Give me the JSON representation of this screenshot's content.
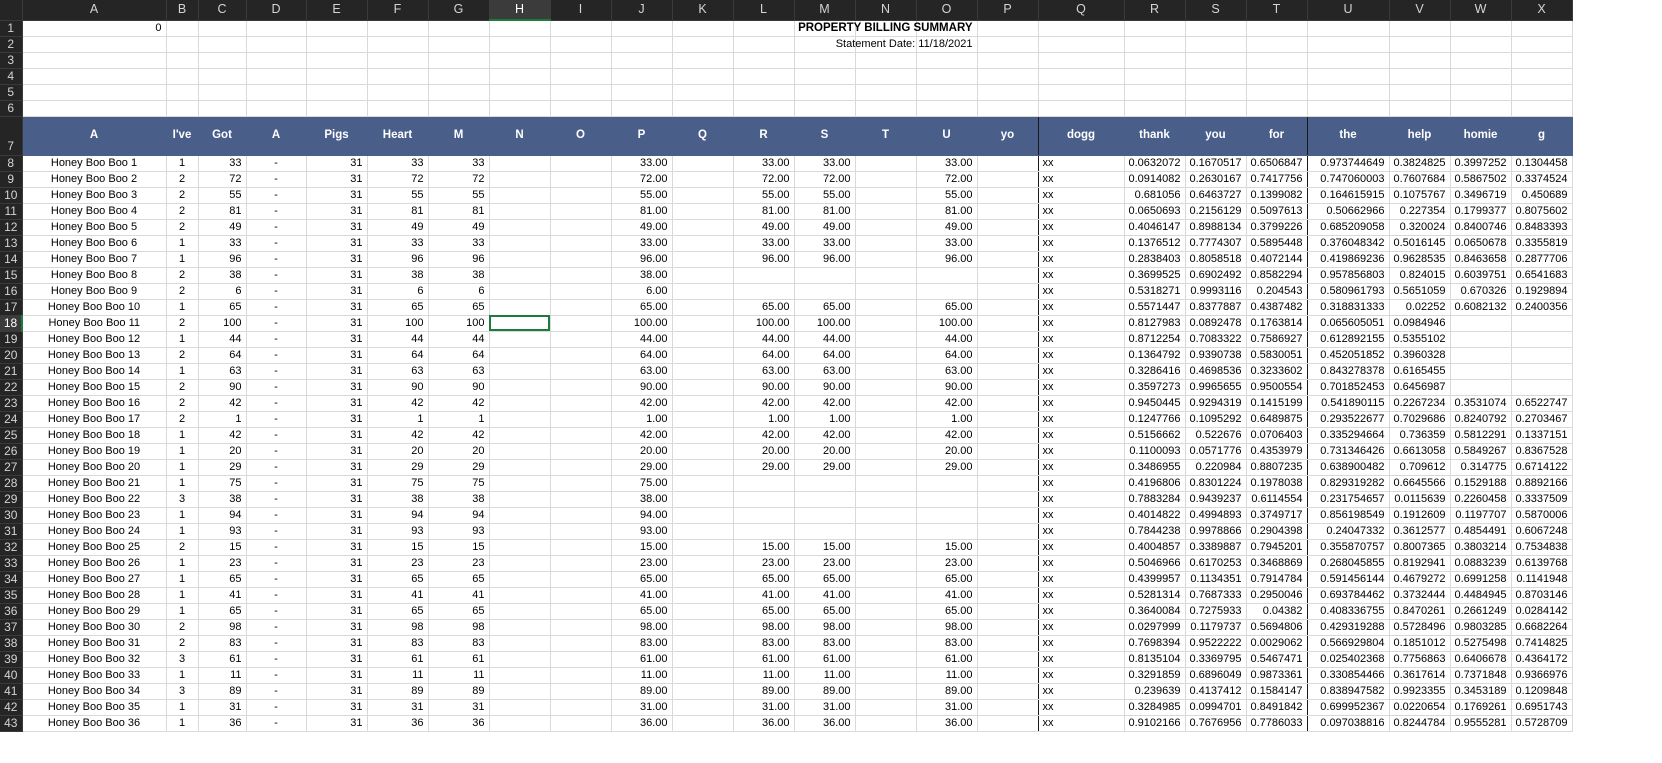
{
  "columns": [
    "A",
    "B",
    "C",
    "D",
    "E",
    "F",
    "G",
    "H",
    "I",
    "J",
    "K",
    "L",
    "M",
    "N",
    "O",
    "P",
    "Q",
    "R",
    "S",
    "T",
    "U",
    "V",
    "W",
    "X"
  ],
  "selected_column": "H",
  "selected_row": "18",
  "top": {
    "b1_value": "0",
    "title": "PROPERTY BILLING SUMMARY",
    "statement": "Statement Date: 11/18/2021"
  },
  "header_row": [
    "A",
    "I've",
    "Got",
    "A",
    "Pigs",
    "Heart",
    "M",
    "N",
    "O",
    "P",
    "Q",
    "R",
    "S",
    "T",
    "U",
    "yo",
    "dogg",
    "thank",
    "you",
    "for",
    "the",
    "help",
    "homie",
    "g"
  ],
  "accent_color": "#4a5e8a",
  "rows": [
    [
      "8",
      "Honey Boo Boo 1",
      "1",
      "33",
      "-",
      "31",
      "33",
      "33",
      "",
      "",
      "33.00",
      "",
      "33.00",
      "33.00",
      "",
      "33.00",
      "",
      "xx",
      "0.0632072",
      "0.1670517",
      "0.6506847",
      "0.973744649",
      "0.3824825",
      "0.3997252",
      "0.1304458"
    ],
    [
      "9",
      "Honey Boo Boo 2",
      "2",
      "72",
      "-",
      "31",
      "72",
      "72",
      "",
      "",
      "72.00",
      "",
      "72.00",
      "72.00",
      "",
      "72.00",
      "",
      "xx",
      "0.0914082",
      "0.2630167",
      "0.7417756",
      "0.747060003",
      "0.7607684",
      "0.5867502",
      "0.3374524"
    ],
    [
      "10",
      "Honey Boo Boo 3",
      "2",
      "55",
      "-",
      "31",
      "55",
      "55",
      "",
      "",
      "55.00",
      "",
      "55.00",
      "55.00",
      "",
      "55.00",
      "",
      "xx",
      "0.681056",
      "0.6463727",
      "0.1399082",
      "0.164615915",
      "0.1075767",
      "0.3496719",
      "0.450689"
    ],
    [
      "11",
      "Honey Boo Boo 4",
      "2",
      "81",
      "-",
      "31",
      "81",
      "81",
      "",
      "",
      "81.00",
      "",
      "81.00",
      "81.00",
      "",
      "81.00",
      "",
      "xx",
      "0.0650693",
      "0.2156129",
      "0.5097613",
      "0.50662966",
      "0.227354",
      "0.1799377",
      "0.8075602"
    ],
    [
      "12",
      "Honey Boo Boo 5",
      "2",
      "49",
      "-",
      "31",
      "49",
      "49",
      "",
      "",
      "49.00",
      "",
      "49.00",
      "49.00",
      "",
      "49.00",
      "",
      "xx",
      "0.4046147",
      "0.8988134",
      "0.3799226",
      "0.685209058",
      "0.320024",
      "0.8400746",
      "0.8483393"
    ],
    [
      "13",
      "Honey Boo Boo 6",
      "1",
      "33",
      "-",
      "31",
      "33",
      "33",
      "",
      "",
      "33.00",
      "",
      "33.00",
      "33.00",
      "",
      "33.00",
      "",
      "xx",
      "0.1376512",
      "0.7774307",
      "0.5895448",
      "0.376048342",
      "0.5016145",
      "0.0650678",
      "0.3355819"
    ],
    [
      "14",
      "Honey Boo Boo 7",
      "1",
      "96",
      "-",
      "31",
      "96",
      "96",
      "",
      "",
      "96.00",
      "",
      "96.00",
      "96.00",
      "",
      "96.00",
      "",
      "xx",
      "0.2838403",
      "0.8058518",
      "0.4072144",
      "0.419869236",
      "0.9628535",
      "0.8463658",
      "0.2877706"
    ],
    [
      "15",
      "Honey Boo Boo 8",
      "2",
      "38",
      "-",
      "31",
      "38",
      "38",
      "",
      "",
      "38.00",
      "",
      "",
      "",
      "",
      "",
      "",
      "xx",
      "0.3699525",
      "0.6902492",
      "0.8582294",
      "0.957856803",
      "0.824015",
      "0.6039751",
      "0.6541683"
    ],
    [
      "16",
      "Honey Boo Boo 9",
      "2",
      "6",
      "-",
      "31",
      "6",
      "6",
      "",
      "",
      "6.00",
      "",
      "",
      "",
      "",
      "",
      "",
      "xx",
      "0.5318271",
      "0.9993116",
      "0.204543",
      "0.580961793",
      "0.5651059",
      "0.670326",
      "0.1929894"
    ],
    [
      "17",
      "Honey Boo Boo 10",
      "1",
      "65",
      "-",
      "31",
      "65",
      "65",
      "",
      "",
      "65.00",
      "",
      "65.00",
      "65.00",
      "",
      "65.00",
      "",
      "xx",
      "0.5571447",
      "0.8377887",
      "0.4387482",
      "0.318831333",
      "0.02252",
      "0.6082132",
      "0.2400356"
    ],
    [
      "18",
      "Honey Boo Boo 11",
      "2",
      "100",
      "-",
      "31",
      "100",
      "100",
      "",
      "",
      "100.00",
      "",
      "100.00",
      "100.00",
      "",
      "100.00",
      "",
      "xx",
      "0.8127983",
      "0.0892478",
      "0.1763814",
      "0.065605051",
      "0.0984946",
      "",
      ""
    ],
    [
      "19",
      "Honey Boo Boo 12",
      "1",
      "44",
      "-",
      "31",
      "44",
      "44",
      "",
      "",
      "44.00",
      "",
      "44.00",
      "44.00",
      "",
      "44.00",
      "",
      "xx",
      "0.8712254",
      "0.7083322",
      "0.7586927",
      "0.612892155",
      "0.5355102",
      "",
      ""
    ],
    [
      "20",
      "Honey Boo Boo 13",
      "2",
      "64",
      "-",
      "31",
      "64",
      "64",
      "",
      "",
      "64.00",
      "",
      "64.00",
      "64.00",
      "",
      "64.00",
      "",
      "xx",
      "0.1364792",
      "0.9390738",
      "0.5830051",
      "0.452051852",
      "0.3960328",
      "",
      ""
    ],
    [
      "21",
      "Honey Boo Boo 14",
      "1",
      "63",
      "-",
      "31",
      "63",
      "63",
      "",
      "",
      "63.00",
      "",
      "63.00",
      "63.00",
      "",
      "63.00",
      "",
      "xx",
      "0.3286416",
      "0.4698536",
      "0.3233602",
      "0.843278378",
      "0.6165455",
      "",
      ""
    ],
    [
      "22",
      "Honey Boo Boo 15",
      "2",
      "90",
      "-",
      "31",
      "90",
      "90",
      "",
      "",
      "90.00",
      "",
      "90.00",
      "90.00",
      "",
      "90.00",
      "",
      "xx",
      "0.3597273",
      "0.9965655",
      "0.9500554",
      "0.701852453",
      "0.6456987",
      "",
      ""
    ],
    [
      "23",
      "Honey Boo Boo 16",
      "2",
      "42",
      "-",
      "31",
      "42",
      "42",
      "",
      "",
      "42.00",
      "",
      "42.00",
      "42.00",
      "",
      "42.00",
      "",
      "xx",
      "0.9450445",
      "0.9294319",
      "0.1415199",
      "0.541890115",
      "0.2267234",
      "0.3531074",
      "0.6522747"
    ],
    [
      "24",
      "Honey Boo Boo 17",
      "2",
      "1",
      "-",
      "31",
      "1",
      "1",
      "",
      "",
      "1.00",
      "",
      "1.00",
      "1.00",
      "",
      "1.00",
      "",
      "xx",
      "0.1247766",
      "0.1095292",
      "0.6489875",
      "0.293522677",
      "0.7029686",
      "0.8240792",
      "0.2703467"
    ],
    [
      "25",
      "Honey Boo Boo 18",
      "1",
      "42",
      "-",
      "31",
      "42",
      "42",
      "",
      "",
      "42.00",
      "",
      "42.00",
      "42.00",
      "",
      "42.00",
      "",
      "xx",
      "0.5156662",
      "0.522676",
      "0.0706403",
      "0.335294664",
      "0.736359",
      "0.5812291",
      "0.1337151"
    ],
    [
      "26",
      "Honey Boo Boo 19",
      "1",
      "20",
      "-",
      "31",
      "20",
      "20",
      "",
      "",
      "20.00",
      "",
      "20.00",
      "20.00",
      "",
      "20.00",
      "",
      "xx",
      "0.1100093",
      "0.0571776",
      "0.4353979",
      "0.731346426",
      "0.6613058",
      "0.5849267",
      "0.8367528"
    ],
    [
      "27",
      "Honey Boo Boo 20",
      "1",
      "29",
      "-",
      "31",
      "29",
      "29",
      "",
      "",
      "29.00",
      "",
      "29.00",
      "29.00",
      "",
      "29.00",
      "",
      "xx",
      "0.3486955",
      "0.220984",
      "0.8807235",
      "0.638900482",
      "0.709612",
      "0.314775",
      "0.6714122"
    ],
    [
      "28",
      "Honey Boo Boo 21",
      "1",
      "75",
      "-",
      "31",
      "75",
      "75",
      "",
      "",
      "75.00",
      "",
      "",
      "",
      "",
      "",
      "",
      "xx",
      "0.4196806",
      "0.8301224",
      "0.1978038",
      "0.829319282",
      "0.6645566",
      "0.1529188",
      "0.8892166"
    ],
    [
      "29",
      "Honey Boo Boo 22",
      "3",
      "38",
      "-",
      "31",
      "38",
      "38",
      "",
      "",
      "38.00",
      "",
      "",
      "",
      "",
      "",
      "",
      "xx",
      "0.7883284",
      "0.9439237",
      "0.6114554",
      "0.231754657",
      "0.0115639",
      "0.2260458",
      "0.3337509"
    ],
    [
      "30",
      "Honey Boo Boo 23",
      "1",
      "94",
      "-",
      "31",
      "94",
      "94",
      "",
      "",
      "94.00",
      "",
      "",
      "",
      "",
      "",
      "",
      "xx",
      "0.4014822",
      "0.4994893",
      "0.3749717",
      "0.856198549",
      "0.1912609",
      "0.1197707",
      "0.5870006"
    ],
    [
      "31",
      "Honey Boo Boo 24",
      "1",
      "93",
      "-",
      "31",
      "93",
      "93",
      "",
      "",
      "93.00",
      "",
      "",
      "",
      "",
      "",
      "",
      "xx",
      "0.7844238",
      "0.9978866",
      "0.2904398",
      "0.24047332",
      "0.3612577",
      "0.4854491",
      "0.6067248"
    ],
    [
      "32",
      "Honey Boo Boo 25",
      "2",
      "15",
      "-",
      "31",
      "15",
      "15",
      "",
      "",
      "15.00",
      "",
      "15.00",
      "15.00",
      "",
      "15.00",
      "",
      "xx",
      "0.4004857",
      "0.3389887",
      "0.7945201",
      "0.355870757",
      "0.8007365",
      "0.3803214",
      "0.7534838"
    ],
    [
      "33",
      "Honey Boo Boo 26",
      "1",
      "23",
      "-",
      "31",
      "23",
      "23",
      "",
      "",
      "23.00",
      "",
      "23.00",
      "23.00",
      "",
      "23.00",
      "",
      "xx",
      "0.5046966",
      "0.6170253",
      "0.3468869",
      "0.268045855",
      "0.8192941",
      "0.0883239",
      "0.6139768"
    ],
    [
      "34",
      "Honey Boo Boo 27",
      "1",
      "65",
      "-",
      "31",
      "65",
      "65",
      "",
      "",
      "65.00",
      "",
      "65.00",
      "65.00",
      "",
      "65.00",
      "",
      "xx",
      "0.4399957",
      "0.1134351",
      "0.7914784",
      "0.591456144",
      "0.4679272",
      "0.6991258",
      "0.1141948"
    ],
    [
      "35",
      "Honey Boo Boo 28",
      "1",
      "41",
      "-",
      "31",
      "41",
      "41",
      "",
      "",
      "41.00",
      "",
      "41.00",
      "41.00",
      "",
      "41.00",
      "",
      "xx",
      "0.5281314",
      "0.7687333",
      "0.2950046",
      "0.693784462",
      "0.3732444",
      "0.4484945",
      "0.8703146"
    ],
    [
      "36",
      "Honey Boo Boo 29",
      "1",
      "65",
      "-",
      "31",
      "65",
      "65",
      "",
      "",
      "65.00",
      "",
      "65.00",
      "65.00",
      "",
      "65.00",
      "",
      "xx",
      "0.3640084",
      "0.7275933",
      "0.04382",
      "0.408336755",
      "0.8470261",
      "0.2661249",
      "0.0284142"
    ],
    [
      "37",
      "Honey Boo Boo 30",
      "2",
      "98",
      "-",
      "31",
      "98",
      "98",
      "",
      "",
      "98.00",
      "",
      "98.00",
      "98.00",
      "",
      "98.00",
      "",
      "xx",
      "0.0297999",
      "0.1179737",
      "0.5694806",
      "0.429319288",
      "0.5728496",
      "0.9803285",
      "0.6682264"
    ],
    [
      "38",
      "Honey Boo Boo 31",
      "2",
      "83",
      "-",
      "31",
      "83",
      "83",
      "",
      "",
      "83.00",
      "",
      "83.00",
      "83.00",
      "",
      "83.00",
      "",
      "xx",
      "0.7698394",
      "0.9522222",
      "0.0029062",
      "0.566929804",
      "0.1851012",
      "0.5275498",
      "0.7414825"
    ],
    [
      "39",
      "Honey Boo Boo 32",
      "3",
      "61",
      "-",
      "31",
      "61",
      "61",
      "",
      "",
      "61.00",
      "",
      "61.00",
      "61.00",
      "",
      "61.00",
      "",
      "xx",
      "0.8135104",
      "0.3369795",
      "0.5467471",
      "0.025402368",
      "0.7756863",
      "0.6406678",
      "0.4364172"
    ],
    [
      "40",
      "Honey Boo Boo 33",
      "1",
      "11",
      "-",
      "31",
      "11",
      "11",
      "",
      "",
      "11.00",
      "",
      "11.00",
      "11.00",
      "",
      "11.00",
      "",
      "xx",
      "0.3291859",
      "0.6896049",
      "0.9873361",
      "0.330854466",
      "0.3617614",
      "0.7371848",
      "0.9366976"
    ],
    [
      "41",
      "Honey Boo Boo 34",
      "3",
      "89",
      "-",
      "31",
      "89",
      "89",
      "",
      "",
      "89.00",
      "",
      "89.00",
      "89.00",
      "",
      "89.00",
      "",
      "xx",
      "0.239639",
      "0.4137412",
      "0.1584147",
      "0.838947582",
      "0.9923355",
      "0.3453189",
      "0.1209848"
    ],
    [
      "42",
      "Honey Boo Boo 35",
      "1",
      "31",
      "-",
      "31",
      "31",
      "31",
      "",
      "",
      "31.00",
      "",
      "31.00",
      "31.00",
      "",
      "31.00",
      "",
      "xx",
      "0.3284985",
      "0.0994701",
      "0.8491842",
      "0.699952367",
      "0.0220654",
      "0.1769261",
      "0.6951743"
    ],
    [
      "43",
      "Honey Boo Boo 36",
      "1",
      "36",
      "-",
      "31",
      "36",
      "36",
      "",
      "",
      "36.00",
      "",
      "36.00",
      "36.00",
      "",
      "36.00",
      "",
      "xx",
      "0.9102166",
      "0.7676956",
      "0.7786033",
      "0.097038816",
      "0.8244784",
      "0.9555281",
      "0.5728709"
    ]
  ]
}
